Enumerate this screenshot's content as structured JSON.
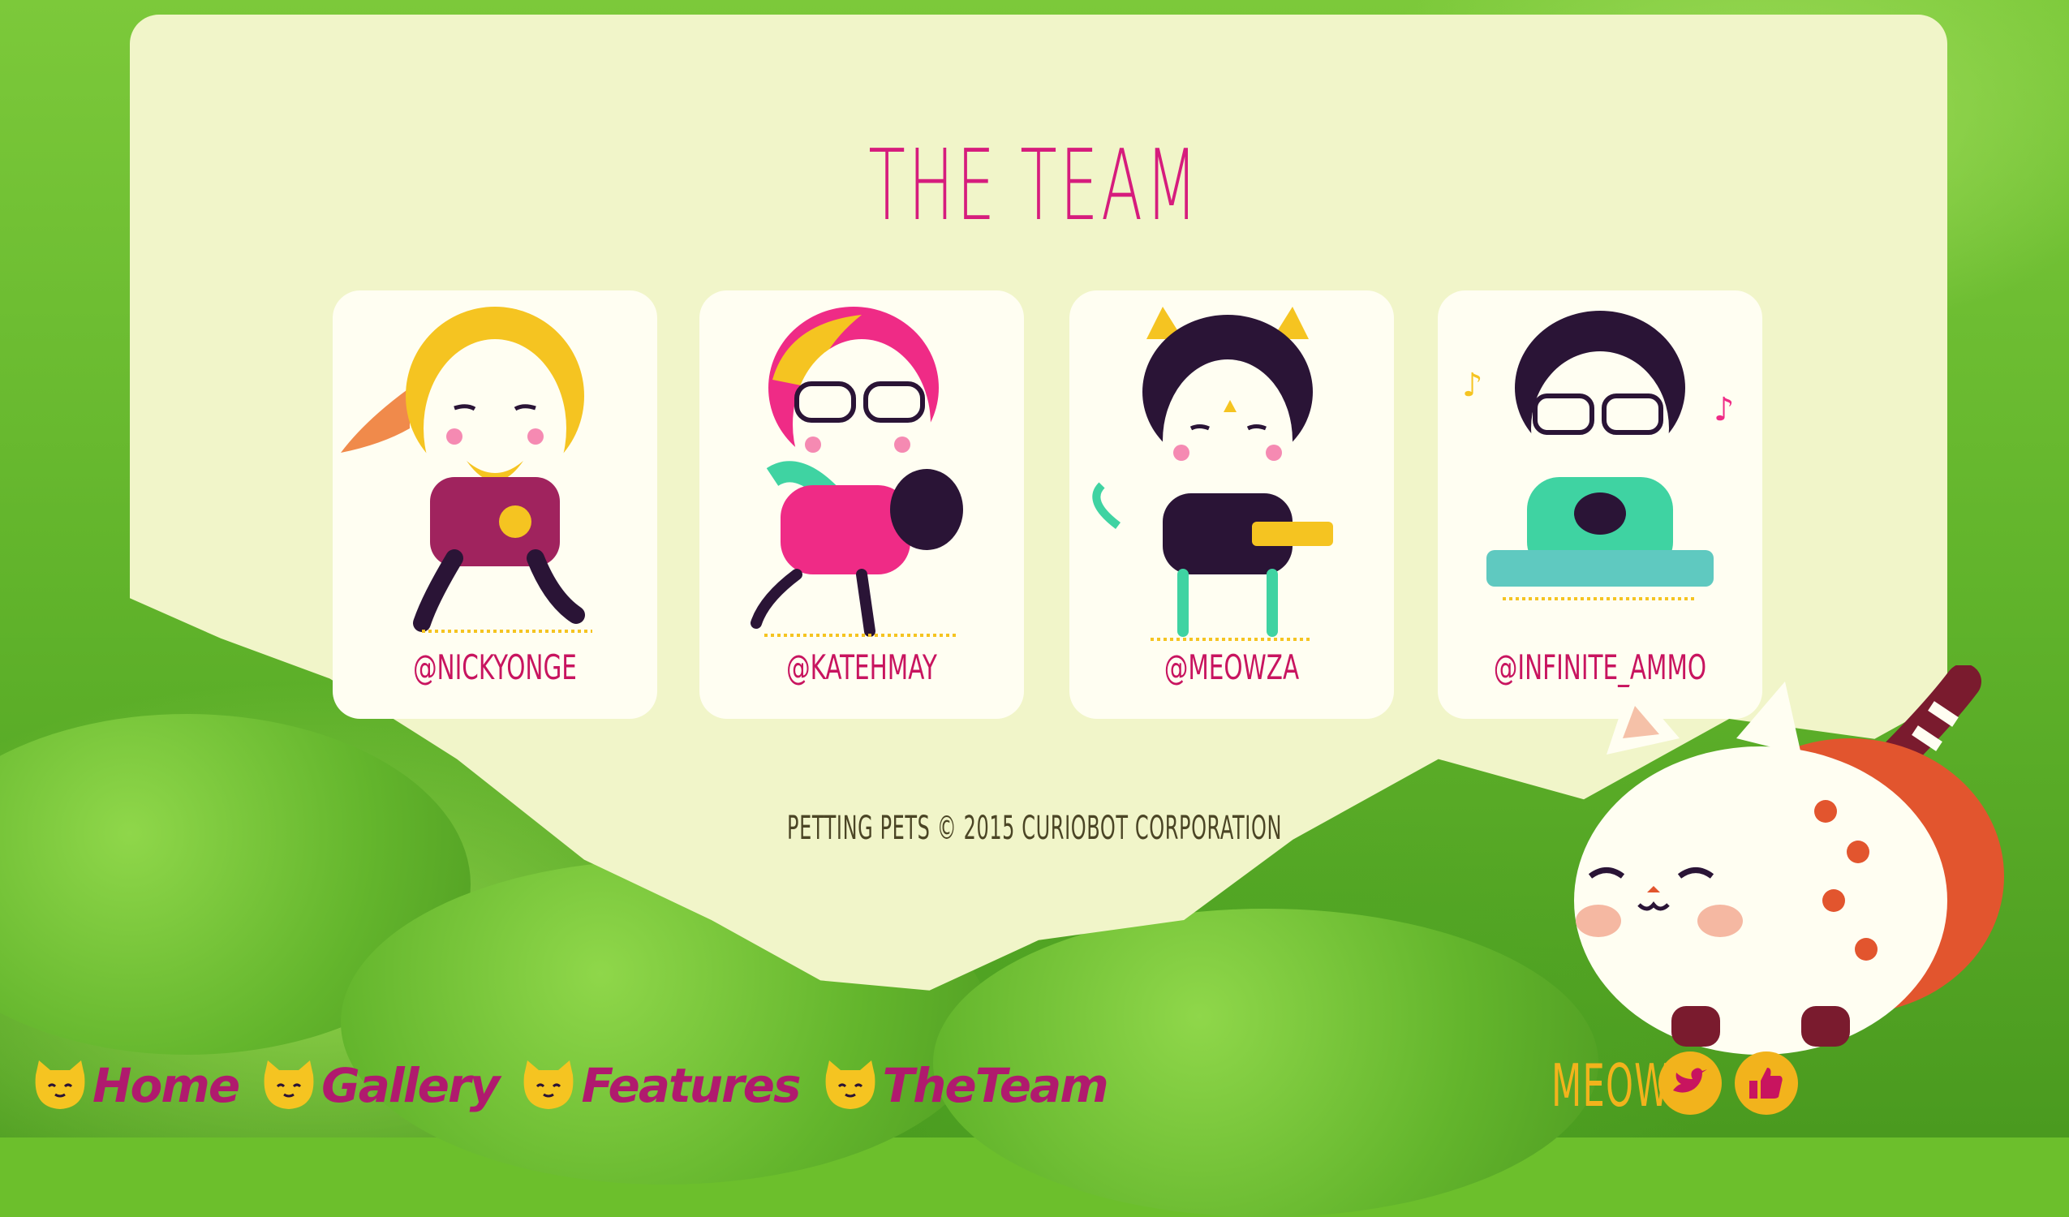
{
  "page": {
    "title": "THE TEAM"
  },
  "team": [
    {
      "handle": "@NICKYONGE",
      "hair": "#f5c421",
      "shirt": "#a0235e",
      "accent": "#f5c421"
    },
    {
      "handle": "@KATEHMAY",
      "hair": "#ef2b86",
      "shirt": "#ef2b86",
      "accent": "#f5c421"
    },
    {
      "handle": "@MEOWZA",
      "hair": "#2a1436",
      "shirt": "#2a1436",
      "accent": "#f5c421"
    },
    {
      "handle": "@INFINITE_AMMO",
      "hair": "#2a1436",
      "shirt": "#3fd3a2",
      "accent": "#f5c421"
    }
  ],
  "footer": {
    "copyright": "PETTING PETS © 2015 CURIOBOT CORPORATION"
  },
  "nav": [
    {
      "label": "Home",
      "icon": "cat-face-icon"
    },
    {
      "label": "Gallery",
      "icon": "cat-face-icon"
    },
    {
      "label": "Features",
      "icon": "cat-face-icon"
    },
    {
      "label": "TheTeam",
      "icon": "cat-face-icon"
    }
  ],
  "social": {
    "meow_label": "MEOW",
    "twitter_icon": "twitter-bird-icon",
    "facebook_icon": "thumbs-up-icon"
  },
  "colors": {
    "panel": "#f1f5c9",
    "title": "#d61c7d",
    "handle": "#c8145f",
    "nav_label": "#b01a6e",
    "social": "#f2b31c"
  }
}
